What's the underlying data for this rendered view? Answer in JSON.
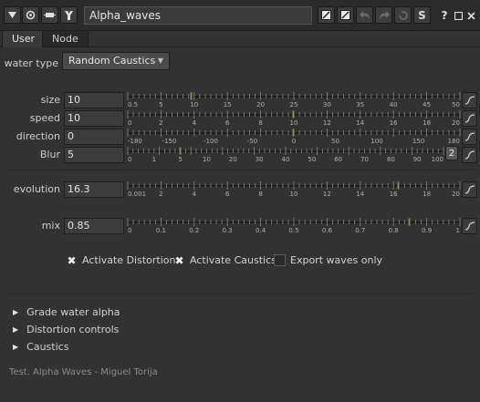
{
  "header": {
    "node_name": "Alpha_waves",
    "icons": [
      "collapse-triangle-icon",
      "settings-icon",
      "node-icon",
      "tools-icon",
      "float-panel-icon",
      "float-panel-alt-icon",
      "undo-icon",
      "redo-icon",
      "revert-icon",
      "snapshot-icon",
      "help-icon",
      "maximize-icon",
      "close-icon"
    ],
    "s_label": "S",
    "help_label": "?"
  },
  "tabs": [
    {
      "label": "User"
    },
    {
      "label": "Node"
    }
  ],
  "water_type": {
    "label": "water type",
    "value": "Random Caustics"
  },
  "params": {
    "size": {
      "label": "size",
      "value": "10",
      "min": 0.5,
      "max": 50,
      "slider_value": 10,
      "ticks": [
        "0.5",
        "5",
        "10",
        "15",
        "20",
        "25",
        "30",
        "35",
        "40",
        "45",
        "50"
      ]
    },
    "speed": {
      "label": "speed",
      "value": "10",
      "min": 0,
      "max": 20,
      "slider_value": 10,
      "ticks": [
        "0",
        "2",
        "4",
        "6",
        "8",
        "10",
        "12",
        "14",
        "16",
        "18",
        "20"
      ]
    },
    "direction": {
      "label": "direction",
      "value": "0",
      "min": -180,
      "max": 180,
      "slider_value": 0,
      "ticks": [
        "-180",
        "-150",
        "-100",
        "-50",
        "0",
        "50",
        "100",
        "150",
        "180"
      ]
    },
    "blur": {
      "label": "Blur",
      "value": "5",
      "slider_value": 5,
      "badge": "2",
      "ticks": [
        "0",
        "1",
        "5",
        "10",
        "20",
        "30",
        "40",
        "50",
        "60",
        "70",
        "80",
        "90",
        "100"
      ]
    },
    "evolution": {
      "label": "evolution",
      "value": "16.3",
      "min": 0.001,
      "max": 20,
      "slider_value": 16.3,
      "ticks": [
        "0.001",
        "2",
        "4",
        "6",
        "8",
        "10",
        "12",
        "14",
        "16",
        "18",
        "20"
      ]
    },
    "mix": {
      "label": "mix",
      "value": "0.85",
      "min": 0,
      "max": 1,
      "slider_value": 0.85,
      "ticks": [
        "0",
        "0.1",
        "0.2",
        "0.3",
        "0.4",
        "0.5",
        "0.6",
        "0.7",
        "0.8",
        "0.9",
        "1"
      ]
    }
  },
  "checkboxes": [
    {
      "label": "Activate Distortion",
      "checked": true
    },
    {
      "label": "Activate Caustics",
      "checked": true
    },
    {
      "label": "Export waves only",
      "checked": false
    }
  ],
  "groups": [
    {
      "label": "Grade water alpha"
    },
    {
      "label": "Distortion controls"
    },
    {
      "label": "Caustics"
    }
  ],
  "footer": "Test. Alpha Waves - Miguel Torija",
  "colors": {
    "panel_bg": "#323232",
    "knob": "#a08f5b",
    "field_bg": "#3c3c3c"
  }
}
